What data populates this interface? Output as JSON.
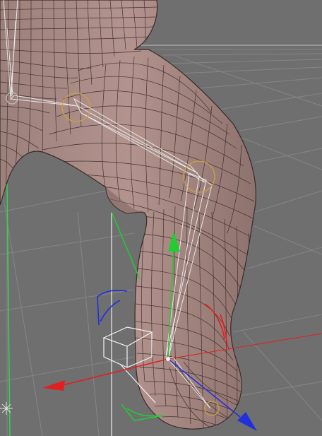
{
  "viewport": {
    "background_color": "#6f6f6f",
    "grid_line_color": "#8a8a8a",
    "horizon_line_color": "#bdbdbd"
  },
  "mesh": {
    "skin_color": "#a88b86",
    "skin_shadow_color": "#8f7470",
    "wire_color": "#3a2a28"
  },
  "skeleton": {
    "bone_color": "#e8e8e8",
    "joint_ring_color": "#c9a24a"
  },
  "gizmo": {
    "x_axis_color": "#e02020",
    "y_axis_color": "#22cc33",
    "z_axis_color": "#2030dd",
    "icons": [
      "move-gizmo-x-arrow-icon",
      "move-gizmo-y-arrow-icon",
      "move-gizmo-z-arrow-icon",
      "selection-box-icon"
    ]
  },
  "light_icon": "light-source-icon"
}
